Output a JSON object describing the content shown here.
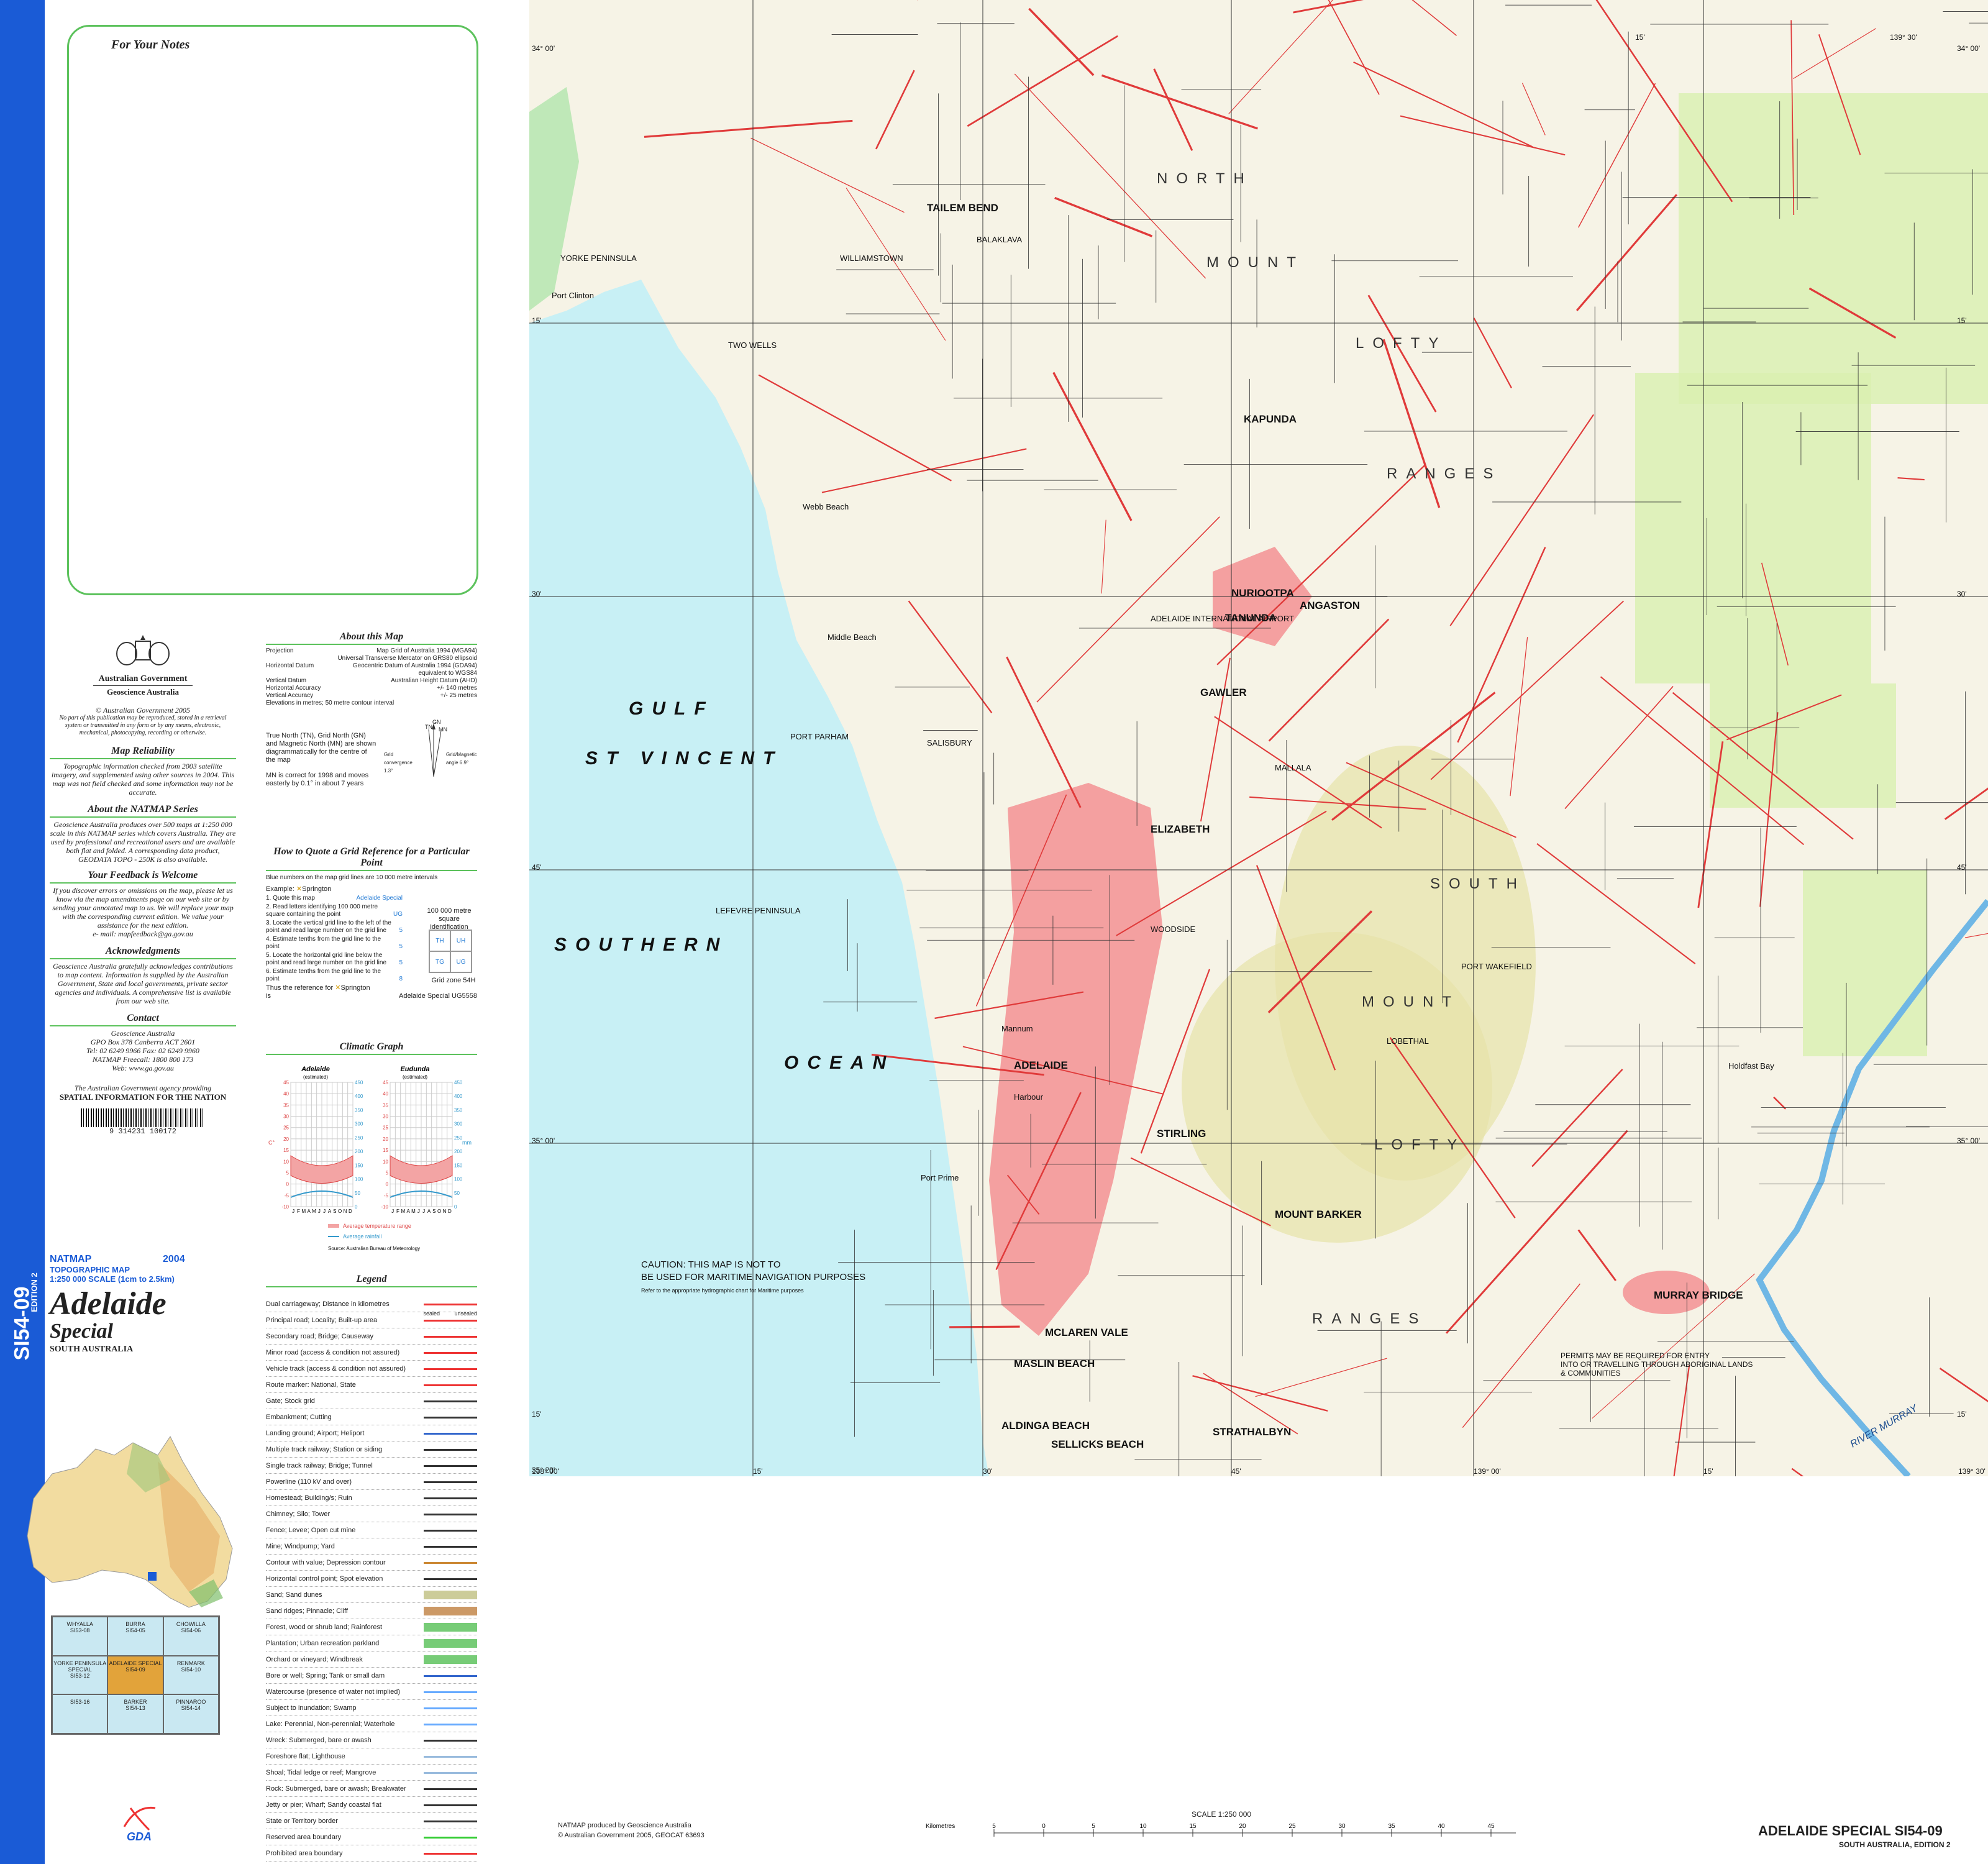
{
  "notes": {
    "title": "For Your Notes"
  },
  "gov": {
    "name": "Australian Government",
    "agency": "Geoscience Australia",
    "copyright": "© Australian Government 2005",
    "copyright_text": "No part of this publication may be reproduced, stored in a retrieval system or transmitted in any form or by any means, electronic, mechanical, photocopying, recording or otherwise."
  },
  "reliability": {
    "title": "Map Reliability",
    "text": "Topographic information checked from 2003 satellite imagery, and supplemented using other sources in 2004. This map was not field checked and some information may not be accurate."
  },
  "natmap_series": {
    "title": "About the NATMAP Series",
    "text": "Geoscience Australia produces over 500 maps at 1:250 000 scale in this NATMAP series which covers Australia. They are used by professional and recreational users and are available both flat and folded. A corresponding data product, GEODATA TOPO - 250K is also available."
  },
  "feedback": {
    "title": "Your Feedback is Welcome",
    "text": "If you discover errors or omissions on the map, please let us know via the map amendments page on our web site or by sending your annotated map to us. We will replace your map with the corresponding current edition. We value your assistance for the next edition.",
    "email": "e- mail: mapfeedback@ga.gov.au"
  },
  "ack": {
    "title": "Acknowledgments",
    "text": "Geoscience Australia gratefully acknowledges contributions to map content. Information is supplied by the Australian Government, State and local governments, private sector agencies and individuals. A comprehensive list is available from our web site."
  },
  "contact": {
    "title": "Contact",
    "l1": "Geoscience Australia",
    "l2": "GPO Box 378 Canberra ACT 2601",
    "l3": "Tel: 02 6249 9966 Fax: 02 6249 9960",
    "l4": "NATMAP Freecall: 1800 800 173",
    "l5": "Web: www.ga.gov.au",
    "agency_line": "The Australian Government agency providing",
    "spatial": "SPATIAL INFORMATION FOR THE NATION",
    "barcode": "9 314231 100172"
  },
  "about": {
    "title": "About this Map",
    "rows": [
      [
        "Projection",
        "Map Grid of Australia 1994 (MGA94)"
      ],
      [
        "",
        "Universal Transverse Mercator on GRS80 ellipsoid"
      ],
      [
        "Horizontal Datum",
        "Geocentric Datum of Australia 1994 (GDA94)"
      ],
      [
        "",
        "equivalent to WGS84"
      ],
      [
        "Vertical Datum",
        "Australian Height Datum (AHD)"
      ],
      [
        "Horizontal Accuracy",
        "+/- 140 metres"
      ],
      [
        "Vertical Accuracy",
        "+/- 25 metres"
      ],
      [
        "Elevations in metres; 50 metre contour interval",
        ""
      ]
    ],
    "north_text": "True North (TN), Grid North (GN) and Magnetic North (MN) are shown diagrammatically for the centre of the map",
    "mn_text": "MN is correct for 1998 and moves easterly by 0.1° in about 7 years",
    "gn": "GN",
    "tn": "TN",
    "mn": "MN",
    "grid_conv": "Grid convergence 1.3°",
    "mag_angle": "Grid/Magnetic angle 6.9°"
  },
  "quote": {
    "title": "How to Quote a Grid Reference for a Particular Point",
    "intro": "Blue numbers on the map grid lines are 10 000 metre intervals",
    "example": "Example:",
    "example_place": "Springton",
    "steps": [
      [
        "1. Quote this map",
        "Adelaide Special"
      ],
      [
        "2. Read letters identifying 100 000 metre square containing the point",
        "UG"
      ],
      [
        "3. Locate the vertical grid line to the left of the point and read large number on the grid line",
        "5"
      ],
      [
        "4. Estimate tenths from the grid line to the point",
        "5"
      ],
      [
        "5. Locate the horizontal grid line below the point and read large number on the grid line",
        "5"
      ],
      [
        "6. Estimate tenths from the grid line to the point",
        "8"
      ]
    ],
    "result_label": "Thus the reference for",
    "result_place": "Springton",
    "result_is": "is",
    "result": "Adelaide Special UG5558",
    "square_title": "100 000 metre square identification",
    "squares": [
      "TH",
      "UH",
      "TG",
      "UG"
    ],
    "zone": "Grid zone 54H"
  },
  "climate": {
    "title": "Climatic Graph",
    "station1": "Adelaide",
    "station2": "Eudunda",
    "estimated": "(estimated)",
    "months": [
      "J",
      "F",
      "M",
      "A",
      "M",
      "J",
      "J",
      "A",
      "S",
      "O",
      "N",
      "D"
    ],
    "temp_label": "C°",
    "rain_label": "mm",
    "temp_ticks": [
      "45",
      "40",
      "35",
      "30",
      "25",
      "20",
      "15",
      "10",
      "5",
      "0",
      "-5",
      "-10"
    ],
    "rain_ticks": [
      "450",
      "400",
      "350",
      "300",
      "250",
      "200",
      "150",
      "100",
      "50",
      "0"
    ],
    "legend_temp": "Average temperature range",
    "legend_rain": "Average rainfall",
    "source": "Source: Australian Bureau of Meteorology"
  },
  "title_block": {
    "natmap": "NATMAP",
    "type": "TOPOGRAPHIC MAP",
    "scale": "1:250 000 SCALE (1cm to 2.5km)",
    "year": "2004",
    "name": "Adelaide",
    "sub": "Special",
    "state": "SOUTH AUSTRALIA",
    "code": "SI54-09",
    "edition": "EDITION 2"
  },
  "index": {
    "cells": [
      [
        "WHYALLA",
        "SI53-08"
      ],
      [
        "BURRA",
        "SI54-05"
      ],
      [
        "CHOWILLA",
        "SI54-06"
      ],
      [
        "YORKE PENINSULA SPECIAL",
        "SI53-12"
      ],
      [
        "ADELAIDE SPECIAL",
        "SI54-09"
      ],
      [
        "RENMARK",
        "SI54-10"
      ],
      [
        "",
        "SI53-16"
      ],
      [
        "BARKER",
        "SI54-13"
      ],
      [
        "PINNAROO",
        "SI54-14"
      ]
    ]
  },
  "legend": {
    "title": "Legend",
    "sealed": "sealed",
    "unsealed": "unsealed",
    "items": [
      "Dual carriageway; Distance in kilometres",
      "Principal road; Locality; Built-up area",
      "Secondary road; Bridge; Causeway",
      "Minor road (access & condition not assured)",
      "Vehicle track (access & condition not assured)",
      "Route marker: National, State",
      "Gate; Stock grid",
      "Embankment; Cutting",
      "Landing ground; Airport; Heliport",
      "Multiple track railway; Station or siding",
      "Single track railway; Bridge; Tunnel",
      "Powerline (110 kV and over)",
      "Homestead; Building/s; Ruin",
      "Chimney; Silo; Tower",
      "Fence; Levee; Open cut mine",
      "Mine; Windpump; Yard",
      "Contour with value; Depression contour",
      "Horizontal control point; Spot elevation",
      "Sand; Sand dunes",
      "Sand ridges; Pinnacle; Cliff",
      "Forest, wood or shrub land; Rainforest",
      "Plantation; Urban recreation parkland",
      "Orchard or vineyard; Windbreak",
      "Bore or well; Spring; Tank or small dam",
      "Watercourse (presence of water not implied)",
      "Subject to inundation; Swamp",
      "Lake: Perennial, Non-perennial; Waterhole",
      "Wreck: Submerged, bare or awash",
      "Foreshore flat; Lighthouse",
      "Shoal; Tidal ledge or reef; Mangrove",
      "Rock: Submerged, bare or awash; Breakwater",
      "Jetty or pier; Wharf; Sandy coastal flat",
      "State or Territory border",
      "Reserved area boundary",
      "Prohibited area boundary"
    ]
  },
  "map": {
    "places": [
      "ADELAIDE",
      "GAWLER",
      "ELIZABETH",
      "NURIOOTPA",
      "ANGASTON",
      "TANUNDA",
      "KAPUNDA",
      "STIRLING",
      "MOUNT BARKER",
      "MURRAY BRIDGE",
      "STRATHALBYN",
      "MCLAREN VALE",
      "SELLICKS BEACH",
      "ALDINGA BEACH",
      "MASLIN BEACH",
      "TAILEM BEND",
      "BALAKLAVA",
      "MALLALA",
      "WILLIAMSTOWN",
      "PORT WAKEFIELD",
      "LOBETHAL",
      "WOODSIDE",
      "SALISBURY",
      "TWO WELLS",
      "PORT PARHAM",
      "LEFEVRE PENINSULA",
      "YORKE PENINSULA",
      "Port Clinton",
      "Webb Beach",
      "Middle Beach",
      "Port Prime",
      "Holdfast Bay",
      "Mannum",
      "Harbour",
      "ADELAIDE INTERNATIONAL AIRPORT"
    ],
    "sea": [
      "GULF",
      "ST VINCENT",
      "SOUTHERN",
      "OCEAN"
    ],
    "ranges": [
      "NORTH",
      "MOUNT",
      "LOFTY",
      "RANGES",
      "SOUTH",
      "MOUNT",
      "LOFTY",
      "RANGES"
    ],
    "river": "RIVER MURRAY",
    "caution": "CAUTION: THIS MAP IS NOT TO BE USED FOR MARITIME NAVIGATION PURPOSES",
    "caution_small": "Refer to the appropriate hydrographic chart for Maritime purposes",
    "permits": "PERMITS MAY BE REQUIRED FOR ENTRY INTO OR TRAVELLING THROUGH ABORIGINAL LANDS & COMMUNITIES",
    "lat_labels": [
      "34° 00'",
      "15'",
      "30'",
      "45'",
      "35° 00'",
      "15'",
      "35° 20'"
    ],
    "lon_labels": [
      "138° 00'",
      "15'",
      "30'",
      "45'",
      "139° 00'",
      "15'",
      "139° 30'"
    ],
    "right_lat": [
      "34° 00'",
      "15'",
      "30'",
      "45'",
      "35° 00'",
      "15'"
    ],
    "top_lon": [
      "15'",
      "139° 30'"
    ]
  },
  "footer": {
    "produced": "NATMAP produced by Geoscience Australia",
    "copy": "© Australian Government 2005, GEOCAT 63693",
    "scale": "SCALE 1:250 000",
    "km": "Kilometres",
    "ticks": [
      "5",
      "0",
      "5",
      "10",
      "15",
      "20",
      "25",
      "30",
      "35",
      "40",
      "45",
      "50"
    ],
    "km_end": "Kilometres",
    "sheet": "ADELAIDE SPECIAL SI54-09",
    "edition": "SOUTH AUSTRALIA, EDITION 2",
    "gda": "GDA"
  }
}
